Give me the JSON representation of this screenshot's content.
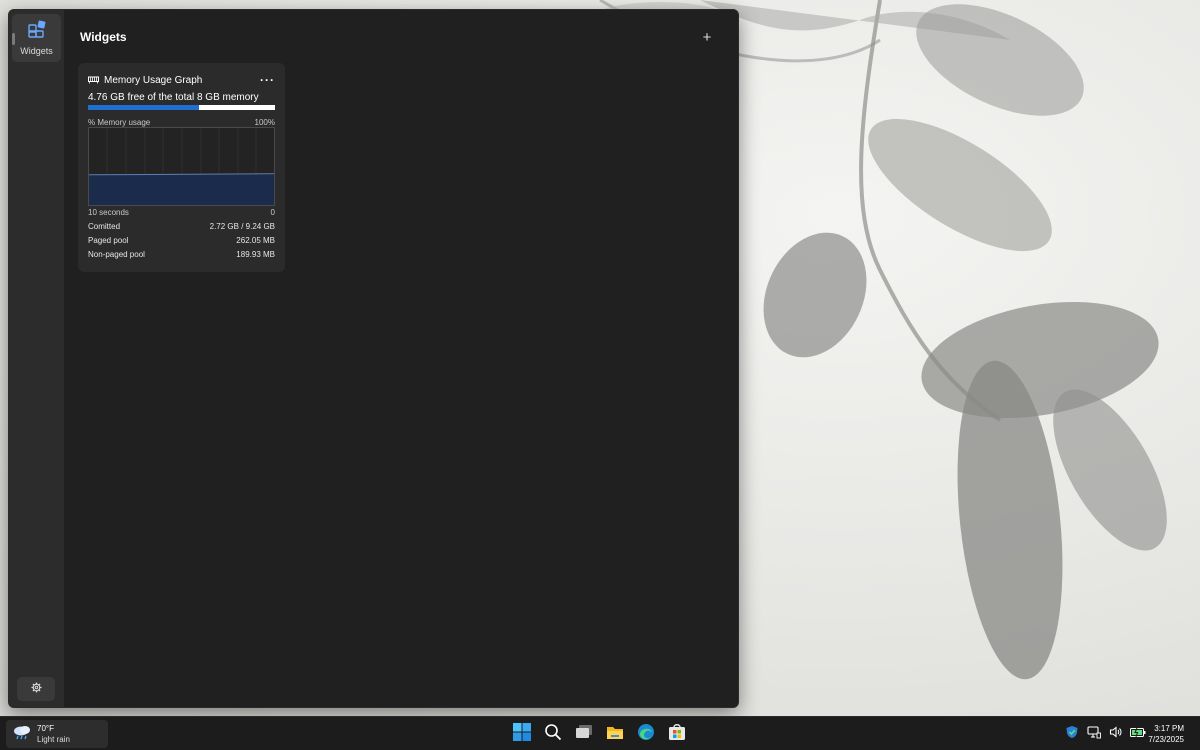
{
  "board": {
    "title": "Widgets",
    "rail_item_label": "Widgets",
    "add_label": "+"
  },
  "widget": {
    "title": "Memory Usage Graph",
    "more_label": "···",
    "free_text": "4.76 GB free of the total 8 GB memory",
    "used_fraction": 0.595,
    "chart_label_left": "% Memory usage",
    "chart_label_right": "100%",
    "axis_left": "10 seconds",
    "axis_right": "0",
    "graph_usage_percent": 40,
    "stats": [
      {
        "label": "Comitted",
        "value": "2.72 GB / 9.24 GB"
      },
      {
        "label": "Paged pool",
        "value": "262.05 MB"
      },
      {
        "label": "Non-paged pool",
        "value": "189.93 MB"
      }
    ]
  },
  "taskbar": {
    "weather_temp": "70°F",
    "weather_cond": "Light rain",
    "clock_time": "3:17 PM",
    "clock_date": "7/23/2025",
    "apps": [
      "start-icon",
      "search-icon",
      "task-view-icon",
      "file-explorer-icon",
      "edge-icon",
      "store-icon"
    ]
  },
  "colors": {
    "accent": "#1f6fd1",
    "board_bg": "#202020",
    "card_bg": "#2b2b2b",
    "graph_fill": "#1b2b4b"
  }
}
